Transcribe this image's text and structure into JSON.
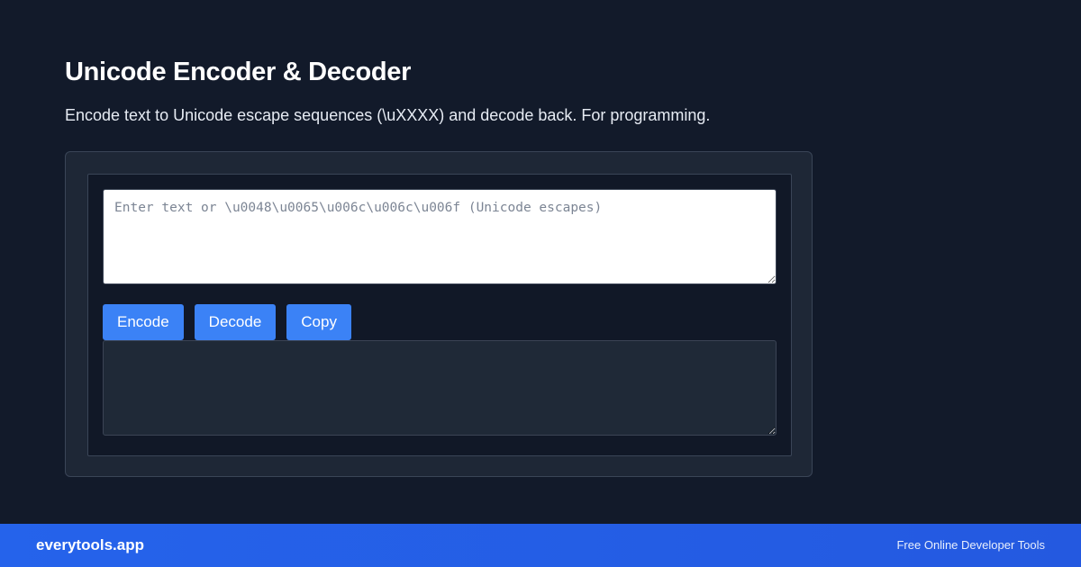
{
  "page": {
    "title": "Unicode Encoder & Decoder",
    "subtitle": "Encode text to Unicode escape sequences (\\uXXXX) and decode back. For programming."
  },
  "tool": {
    "input": {
      "value": "",
      "placeholder": "Enter text or \\u0048\\u0065\\u006c\\u006c\\u006f (Unicode escapes)"
    },
    "buttons": {
      "encode_label": "Encode",
      "decode_label": "Decode",
      "copy_label": "Copy"
    },
    "output": {
      "value": ""
    }
  },
  "footer": {
    "brand": "everytools.app",
    "tagline": "Free Online Developer Tools"
  },
  "colors": {
    "background": "#121a2a",
    "accent": "#3b82f6",
    "footer": "#2563eb"
  }
}
